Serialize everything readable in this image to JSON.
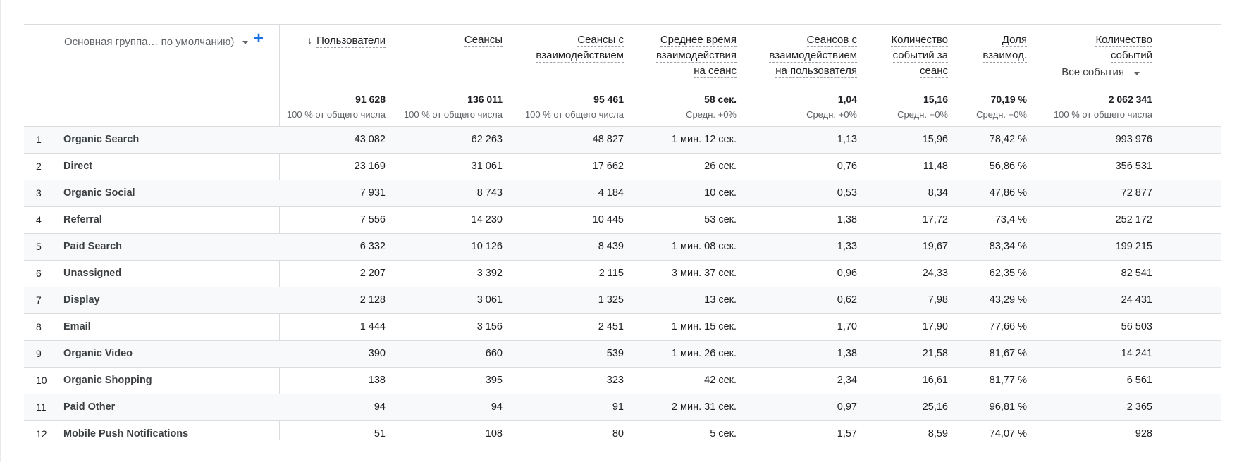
{
  "dimension": {
    "label": "Основная группа… по умолчанию)",
    "add_label": "+"
  },
  "columns": [
    {
      "lines": [
        "Пользователи"
      ],
      "sorted": true,
      "total": "91 628",
      "sub": "100 % от общего числа"
    },
    {
      "lines": [
        "Сеансы"
      ],
      "total": "136 011",
      "sub": "100 % от общего числа"
    },
    {
      "lines": [
        "Сеансы с",
        "взаимодействием"
      ],
      "total": "95 461",
      "sub": "100 % от общего числа"
    },
    {
      "lines": [
        "Среднее время",
        "взаимодействия",
        "на сеанс"
      ],
      "total": "58 сек.",
      "sub": "Средн. +0%"
    },
    {
      "lines": [
        "Сеансов с",
        "взаимодействием",
        "на пользователя"
      ],
      "total": "1,04",
      "sub": "Средн. +0%"
    },
    {
      "lines": [
        "Количество",
        "событий за",
        "сеанс"
      ],
      "total": "15,16",
      "sub": "Средн. +0%"
    },
    {
      "lines": [
        "Доля",
        "взаимод."
      ],
      "total": "70,19 %",
      "sub": "Средн. +0%"
    },
    {
      "lines": [
        "Количество",
        "событий"
      ],
      "event_filter": "Все события",
      "total": "2 062 341",
      "sub": "100 % от общего числа"
    }
  ],
  "rows": [
    {
      "idx": "1",
      "name": "Organic Search",
      "values": [
        "43 082",
        "62 263",
        "48 827",
        "1 мин. 12 сек.",
        "1,13",
        "15,96",
        "78,42 %",
        "993 976"
      ]
    },
    {
      "idx": "2",
      "name": "Direct",
      "values": [
        "23 169",
        "31 061",
        "17 662",
        "26 сек.",
        "0,76",
        "11,48",
        "56,86 %",
        "356 531"
      ]
    },
    {
      "idx": "3",
      "name": "Organic Social",
      "values": [
        "7 931",
        "8 743",
        "4 184",
        "10 сек.",
        "0,53",
        "8,34",
        "47,86 %",
        "72 877"
      ]
    },
    {
      "idx": "4",
      "name": "Referral",
      "values": [
        "7 556",
        "14 230",
        "10 445",
        "53 сек.",
        "1,38",
        "17,72",
        "73,4 %",
        "252 172"
      ]
    },
    {
      "idx": "5",
      "name": "Paid Search",
      "values": [
        "6 332",
        "10 126",
        "8 439",
        "1 мин. 08 сек.",
        "1,33",
        "19,67",
        "83,34 %",
        "199 215"
      ]
    },
    {
      "idx": "6",
      "name": "Unassigned",
      "values": [
        "2 207",
        "3 392",
        "2 115",
        "3 мин. 37 сек.",
        "0,96",
        "24,33",
        "62,35 %",
        "82 541"
      ]
    },
    {
      "idx": "7",
      "name": "Display",
      "values": [
        "2 128",
        "3 061",
        "1 325",
        "13 сек.",
        "0,62",
        "7,98",
        "43,29 %",
        "24 431"
      ]
    },
    {
      "idx": "8",
      "name": "Email",
      "values": [
        "1 444",
        "3 156",
        "2 451",
        "1 мин. 15 сек.",
        "1,70",
        "17,90",
        "77,66 %",
        "56 503"
      ]
    },
    {
      "idx": "9",
      "name": "Organic Video",
      "values": [
        "390",
        "660",
        "539",
        "1 мин. 26 сек.",
        "1,38",
        "21,58",
        "81,67 %",
        "14 241"
      ]
    },
    {
      "idx": "10",
      "name": "Organic Shopping",
      "values": [
        "138",
        "395",
        "323",
        "42 сек.",
        "2,34",
        "16,61",
        "81,77 %",
        "6 561"
      ]
    },
    {
      "idx": "11",
      "name": "Paid Other",
      "values": [
        "94",
        "94",
        "91",
        "2 мин. 31 сек.",
        "0,97",
        "25,16",
        "96,81 %",
        "2 365"
      ]
    },
    {
      "idx": "12",
      "name": "Mobile Push Notifications",
      "values": [
        "51",
        "108",
        "80",
        "5 сек.",
        "1,57",
        "8,59",
        "74,07 %",
        "928"
      ]
    }
  ]
}
